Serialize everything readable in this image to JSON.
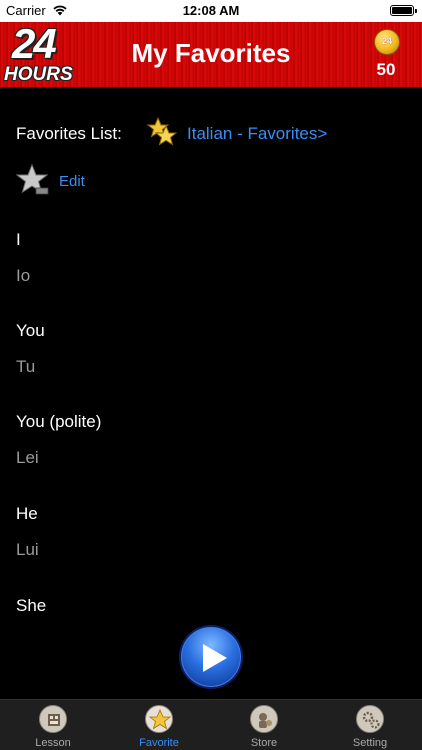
{
  "status_bar": {
    "carrier": "Carrier",
    "time": "12:08 AM"
  },
  "header": {
    "logo_number": "24",
    "logo_word": "HOURS",
    "title": "My Favorites",
    "coin_label": "24",
    "coin_count": "50"
  },
  "favorites": {
    "label": "Favorites List:",
    "list_name": "Italian - Favorites>",
    "edit_label": "Edit"
  },
  "items": [
    {
      "english": "I",
      "italian": "Io"
    },
    {
      "english": "You",
      "italian": "Tu"
    },
    {
      "english": "You (polite)",
      "italian": "Lei"
    },
    {
      "english": "He",
      "italian": "Lui"
    },
    {
      "english": "She",
      "italian": ""
    }
  ],
  "tabs": [
    {
      "label": "Lesson",
      "icon": "lesson-icon"
    },
    {
      "label": "Favorite",
      "icon": "star-icon"
    },
    {
      "label": "Store",
      "icon": "store-icon"
    },
    {
      "label": "Setting",
      "icon": "setting-icon"
    }
  ],
  "colors": {
    "link": "#3a8ef6",
    "header_red": "#d80808",
    "active_tab": "#3a8ef6"
  }
}
